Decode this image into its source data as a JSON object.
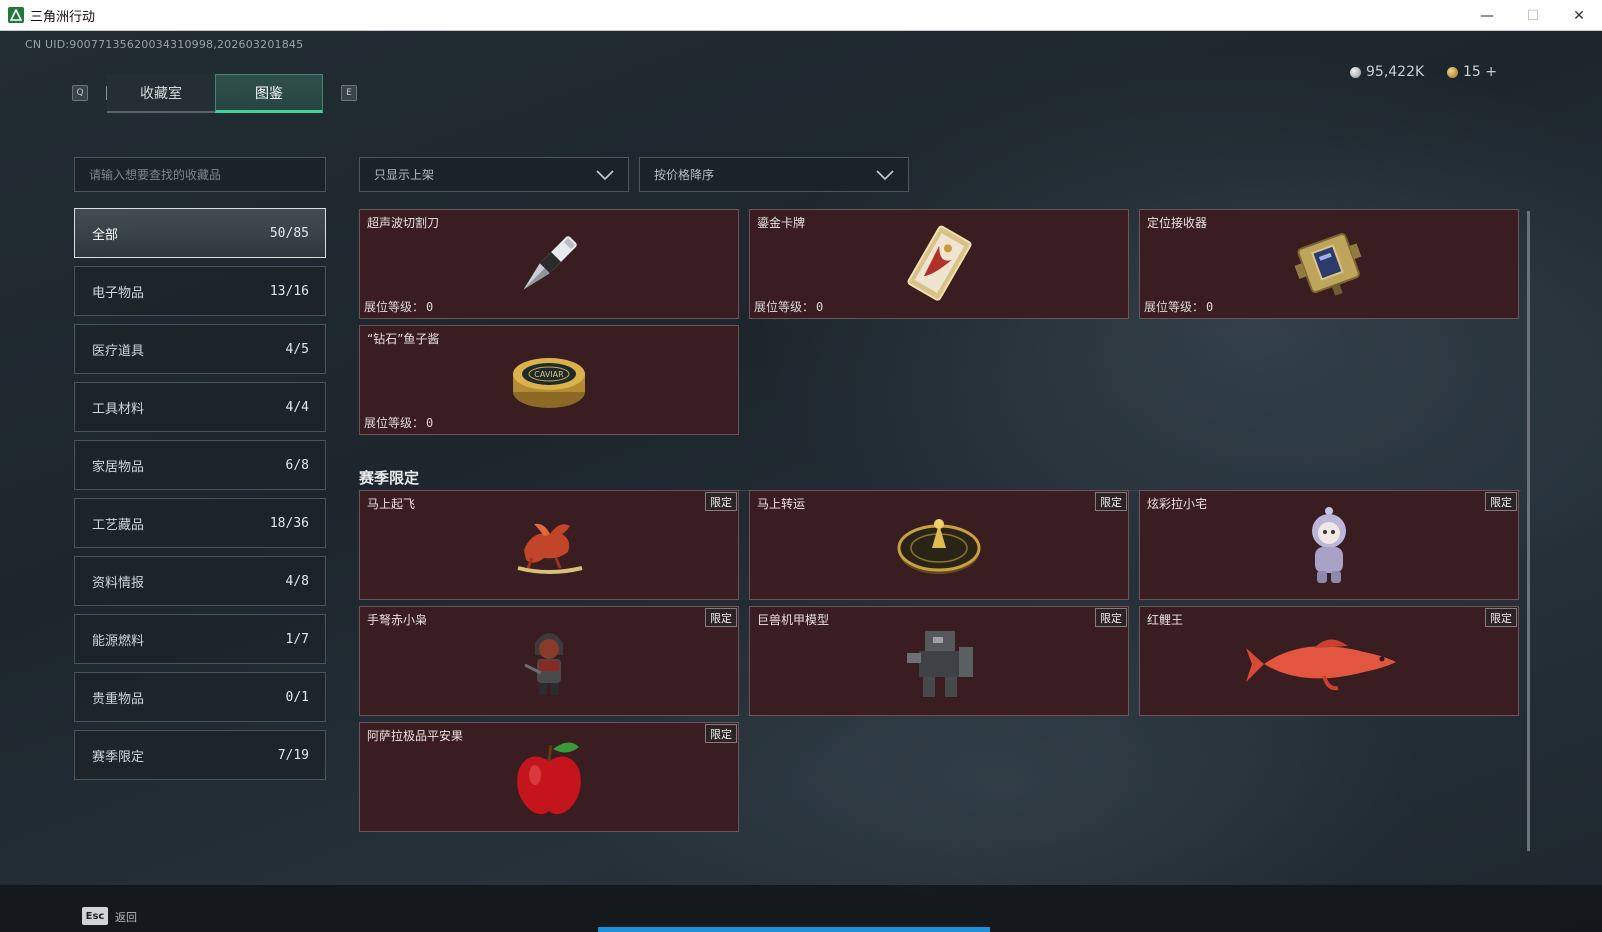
{
  "window": {
    "title": "三角洲行动",
    "minimize": "—",
    "maximize": "☐",
    "close": "✕"
  },
  "uid": "CN UID:90077135620034310998,202603201845",
  "currency": {
    "silver": "95,422K",
    "gold": "15 +"
  },
  "tabs": {
    "left_key": "Q",
    "right_key": "E",
    "items": [
      {
        "label": "收藏室",
        "active": false
      },
      {
        "label": "图鉴",
        "active": true
      }
    ]
  },
  "search": {
    "placeholder": "请输入想要查找的收藏品",
    "value": ""
  },
  "filters": {
    "shelf": "只显示上架",
    "sort": "按价格降序"
  },
  "categories": [
    {
      "label": "全部",
      "count": "50/85",
      "active": true
    },
    {
      "label": "电子物品",
      "count": "13/16"
    },
    {
      "label": "医疗道具",
      "count": "4/5"
    },
    {
      "label": "工具材料",
      "count": "4/4"
    },
    {
      "label": "家居物品",
      "count": "6/8"
    },
    {
      "label": "工艺藏品",
      "count": "18/36"
    },
    {
      "label": "资料情报",
      "count": "4/8"
    },
    {
      "label": "能源燃料",
      "count": "1/7"
    },
    {
      "label": "贵重物品",
      "count": "0/1"
    },
    {
      "label": "赛季限定",
      "count": "7/19"
    }
  ],
  "level_label": "展位等级：",
  "items": [
    {
      "name": "超声波切割刀",
      "level": "0",
      "icon": "ultrasonic-knife"
    },
    {
      "name": "鎏金卡牌",
      "level": "0",
      "icon": "gilded-card"
    },
    {
      "name": "定位接收器",
      "level": "0",
      "icon": "locator-receiver"
    },
    {
      "name": "“钻石”鱼子酱",
      "level": "0",
      "icon": "caviar-tin"
    }
  ],
  "season_section": {
    "title": "赛季限定",
    "badge": "限定",
    "items": [
      {
        "name": "马上起飞",
        "icon": "flying-horse"
      },
      {
        "name": "马上转运",
        "icon": "fortune-wheel"
      },
      {
        "name": "炫彩拉小宅",
        "icon": "astronaut-doll"
      },
      {
        "name": "手弩赤小枭",
        "icon": "crossbow-figure"
      },
      {
        "name": "巨兽机甲模型",
        "icon": "mech-model"
      },
      {
        "name": "红鲤王",
        "icon": "red-carp"
      },
      {
        "name": "阿萨拉极品平安果",
        "icon": "red-apple"
      }
    ]
  },
  "footer": {
    "esc_key": "Esc",
    "esc_label": "返回"
  },
  "colors": {
    "accent": "#3fd39a",
    "card_bg": "#3a1d21",
    "progress": "#1e8fd8"
  }
}
